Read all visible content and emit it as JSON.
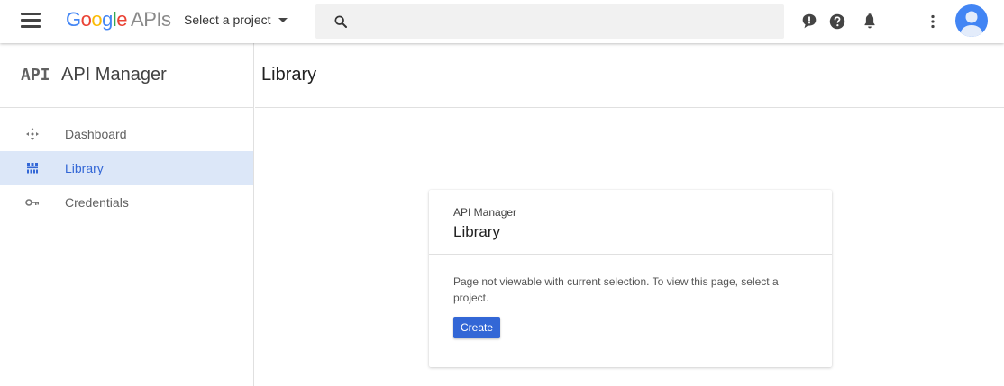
{
  "topbar": {
    "logo_google": "Google",
    "logo_apis": "APIs",
    "project_select_label": "Select a project",
    "search_placeholder": "",
    "icons": [
      "menu-icon",
      "search-icon",
      "feedback-icon",
      "help-icon",
      "notifications-icon",
      "more-vert-icon",
      "account-avatar"
    ]
  },
  "sidebar": {
    "logo_glyph": "API",
    "title": "API Manager",
    "items": [
      {
        "label": "Dashboard",
        "icon": "dashboard-icon",
        "active": false
      },
      {
        "label": "Library",
        "icon": "library-icon",
        "active": true
      },
      {
        "label": "Credentials",
        "icon": "key-icon",
        "active": false
      }
    ]
  },
  "main": {
    "title": "Library",
    "card": {
      "subtitle": "API Manager",
      "title": "Library",
      "message": "Page not viewable with current selection. To view this page, select a project.",
      "button_label": "Create"
    }
  },
  "colors": {
    "accent": "#3367d6",
    "active_nav_bg": "#dce7f8",
    "avatar_bg": "#4285f4"
  }
}
